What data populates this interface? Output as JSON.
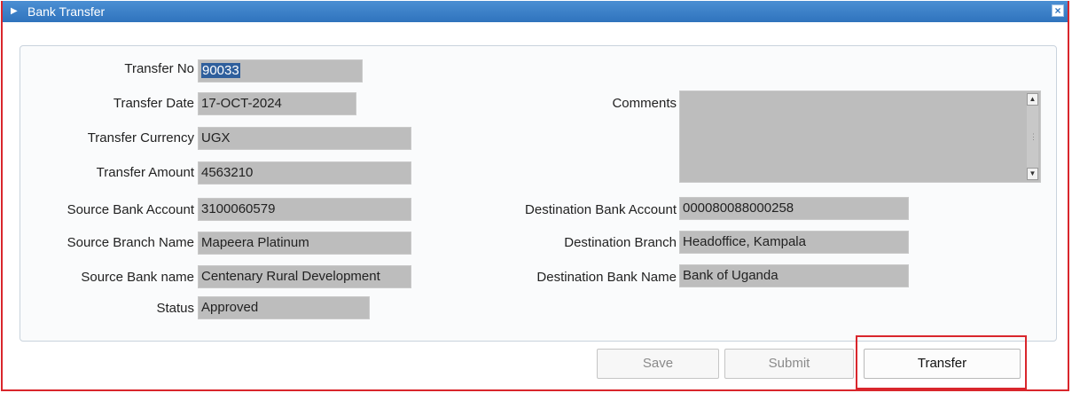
{
  "window": {
    "title": "Bank Transfer",
    "icon": "app-icon",
    "close": "×"
  },
  "form": {
    "transfer_no": {
      "label": "Transfer No",
      "value": "90033"
    },
    "transfer_date": {
      "label": "Transfer Date",
      "value": "17-OCT-2024"
    },
    "transfer_currency": {
      "label": "Transfer Currency",
      "value": "UGX"
    },
    "transfer_amount": {
      "label": "Transfer Amount",
      "value": "4563210"
    },
    "source_bank_account": {
      "label": "Source Bank Account",
      "value": "3100060579"
    },
    "source_branch_name": {
      "label": "Source Branch Name",
      "value": "Mapeera Platinum"
    },
    "source_bank_name": {
      "label": "Source Bank name",
      "value": "Centenary Rural Development"
    },
    "status": {
      "label": "Status",
      "value": "Approved"
    },
    "comments": {
      "label": "Comments",
      "value": ""
    },
    "destination_bank_account": {
      "label": "Destination Bank Account",
      "value": "000080088000258"
    },
    "destination_branch": {
      "label": "Destination Branch",
      "value": "Headoffice, Kampala"
    },
    "destination_bank_name": {
      "label": "Destination Bank Name",
      "value": "Bank of Uganda"
    }
  },
  "buttons": {
    "save": "Save",
    "submit": "Submit",
    "transfer": "Transfer"
  },
  "colors": {
    "titlebar": "#2f73bd",
    "highlight": "#d9262c",
    "field": "#bdbdbd"
  }
}
